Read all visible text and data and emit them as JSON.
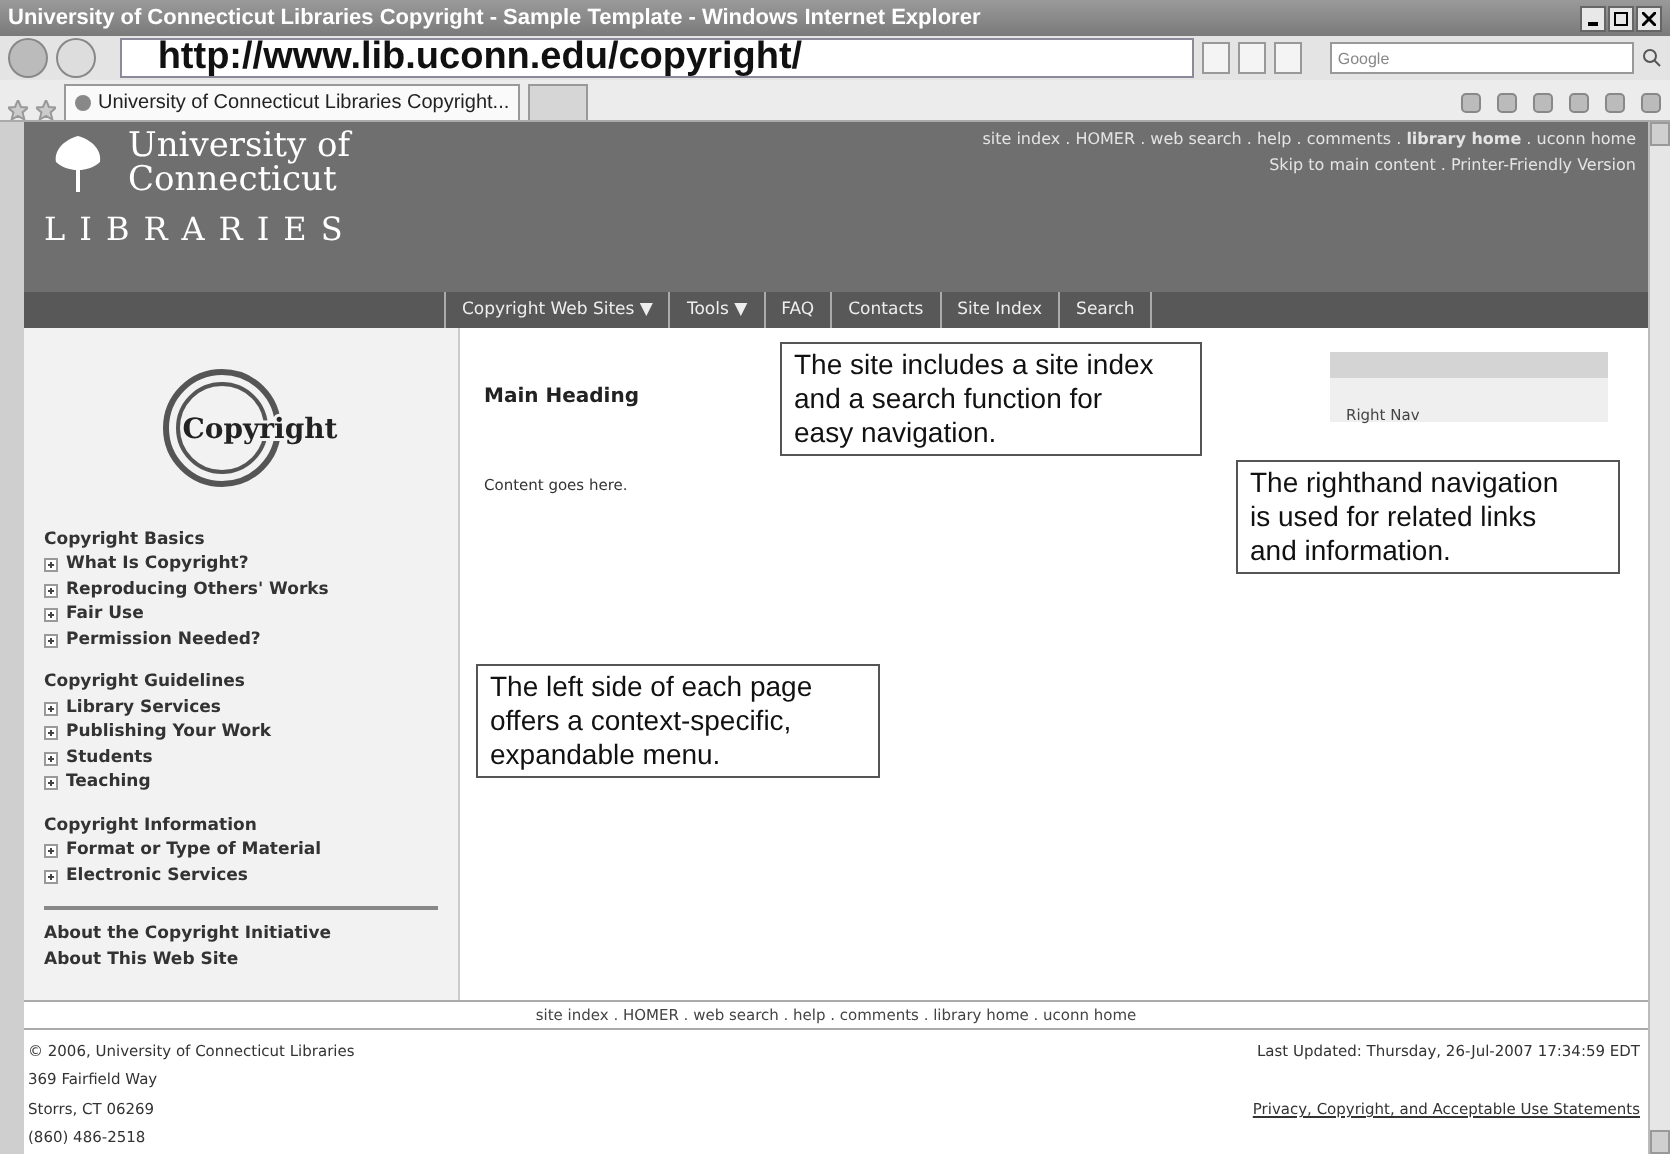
{
  "window": {
    "title": "University of Connecticut Libraries Copyright - Sample Template - Windows Internet Explorer"
  },
  "address_bar": {
    "url": "http://www.lib.uconn.edu/copyright/",
    "search_placeholder": "Google"
  },
  "tabs": [
    {
      "label": "University of Connecticut Libraries Copyright...",
      "selected": true
    },
    {
      "selected": false
    }
  ],
  "header": {
    "logo_lines": [
      "University of",
      "Connecticut"
    ],
    "logo_subtitle": "LIBRARIES",
    "top_links": "site index . HOMER . web search . help . comments . **library home** . uconn home",
    "second_links": "Skip to main content . Printer-Friendly Version"
  },
  "nav": [
    "Copyright Web Sites ▼",
    "Tools ▼",
    "FAQ",
    "Contacts",
    "Site Index",
    "Search"
  ],
  "sidebar": {
    "logo_text": "Copyright",
    "sections": [
      {
        "heading": "Copyright Basics",
        "items": [
          "What Is Copyright?",
          "Reproducing Others' Works",
          "Fair Use",
          "Permission Needed?"
        ]
      },
      {
        "heading": "Copyright Guidelines",
        "items": [
          "Library Services",
          "Publishing Your Work",
          "Students",
          "Teaching"
        ]
      },
      {
        "heading": "Copyright Information",
        "items": [
          "Format or Type of Material",
          "Electronic Services"
        ]
      }
    ],
    "bottom_links": [
      "About the Copyright Initiative",
      "About This Web Site"
    ]
  },
  "main": {
    "heading": "Main Heading",
    "content": "Content goes here."
  },
  "right_nav": {
    "label": "Right Nav"
  },
  "annotations": [
    {
      "text": "The site includes a site index and a search function for easy navigation."
    },
    {
      "text": "The righthand navigation is used for related links and information."
    },
    {
      "text": "The left side of each page offers a context-specific, expandable menu."
    }
  ],
  "footer": {
    "links": "site index . HOMER . web search . help . comments . library home . uconn home",
    "address": [
      "© 2006, University of Connecticut Libraries",
      "369 Fairfield Way",
      "Storrs, CT 06269",
      "(860) 486-2518"
    ],
    "last_updated": "Last Updated: Thursday, 26-Jul-2007 17:34:59 EDT",
    "policy_link": "Privacy, Copyright, and Acceptable Use Statements"
  }
}
